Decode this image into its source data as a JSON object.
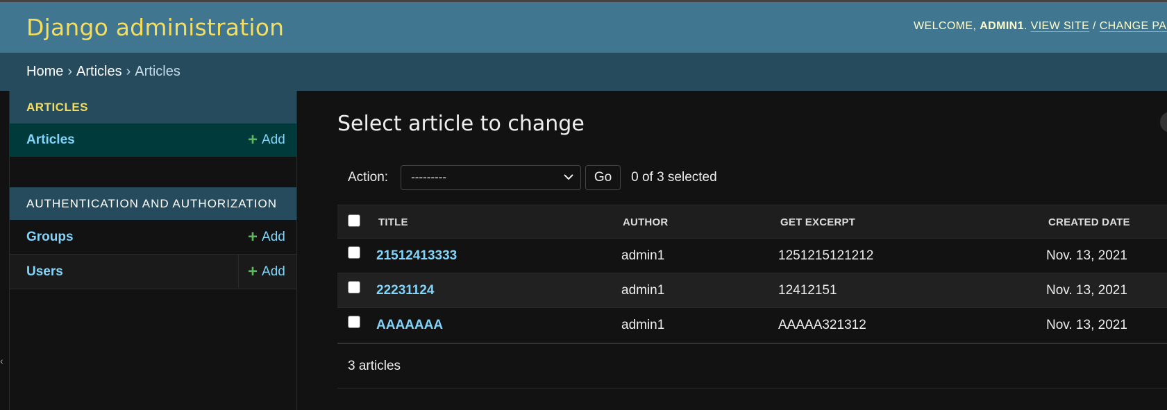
{
  "header": {
    "branding": "Django administration",
    "welcome": "WELCOME,",
    "username": "ADMIN1",
    "view_site": "VIEW SITE",
    "separator": "/",
    "change_password": "CHANGE PAS"
  },
  "breadcrumbs": {
    "home": "Home",
    "sep": "›",
    "app": "Articles",
    "current": "Articles"
  },
  "sidebar": {
    "collapse_glyph": "‹",
    "modules": [
      {
        "caption": "ARTICLES",
        "rows": [
          {
            "name": "Articles",
            "add": "Add"
          }
        ]
      },
      {
        "caption": "AUTHENTICATION AND AUTHORIZATION",
        "rows": [
          {
            "name": "Groups",
            "add": "Add"
          },
          {
            "name": "Users",
            "add": "Add"
          }
        ]
      }
    ],
    "plus_glyph": "+"
  },
  "content": {
    "title": "Select article to change",
    "actions": {
      "label": "Action:",
      "selected": "---------",
      "go": "Go",
      "counter": "0 of 3 selected"
    },
    "table": {
      "columns": [
        "TITLE",
        "AUTHOR",
        "GET EXCERPT",
        "CREATED DATE"
      ],
      "rows": [
        {
          "title": "21512413333",
          "author": "admin1",
          "excerpt": "1251215121212",
          "created": "Nov. 13, 2021"
        },
        {
          "title": "22231124",
          "author": "admin1",
          "excerpt": "12412151",
          "created": "Nov. 13, 2021"
        },
        {
          "title": "AAAAAAA",
          "author": "admin1",
          "excerpt": "AAAAA321312",
          "created": "Nov. 13, 2021"
        }
      ]
    },
    "paginator": "3 articles"
  },
  "colors": {
    "header_bg": "#417690",
    "breadcrumbs_bg": "#264b5d",
    "accent_yellow": "#f5dd5d",
    "link_blue": "#81d4fa",
    "add_green": "#5cb85c",
    "page_bg": "#121212"
  },
  "icons": {
    "select_chevron": "chevron-down-icon",
    "add": "plus-icon"
  }
}
